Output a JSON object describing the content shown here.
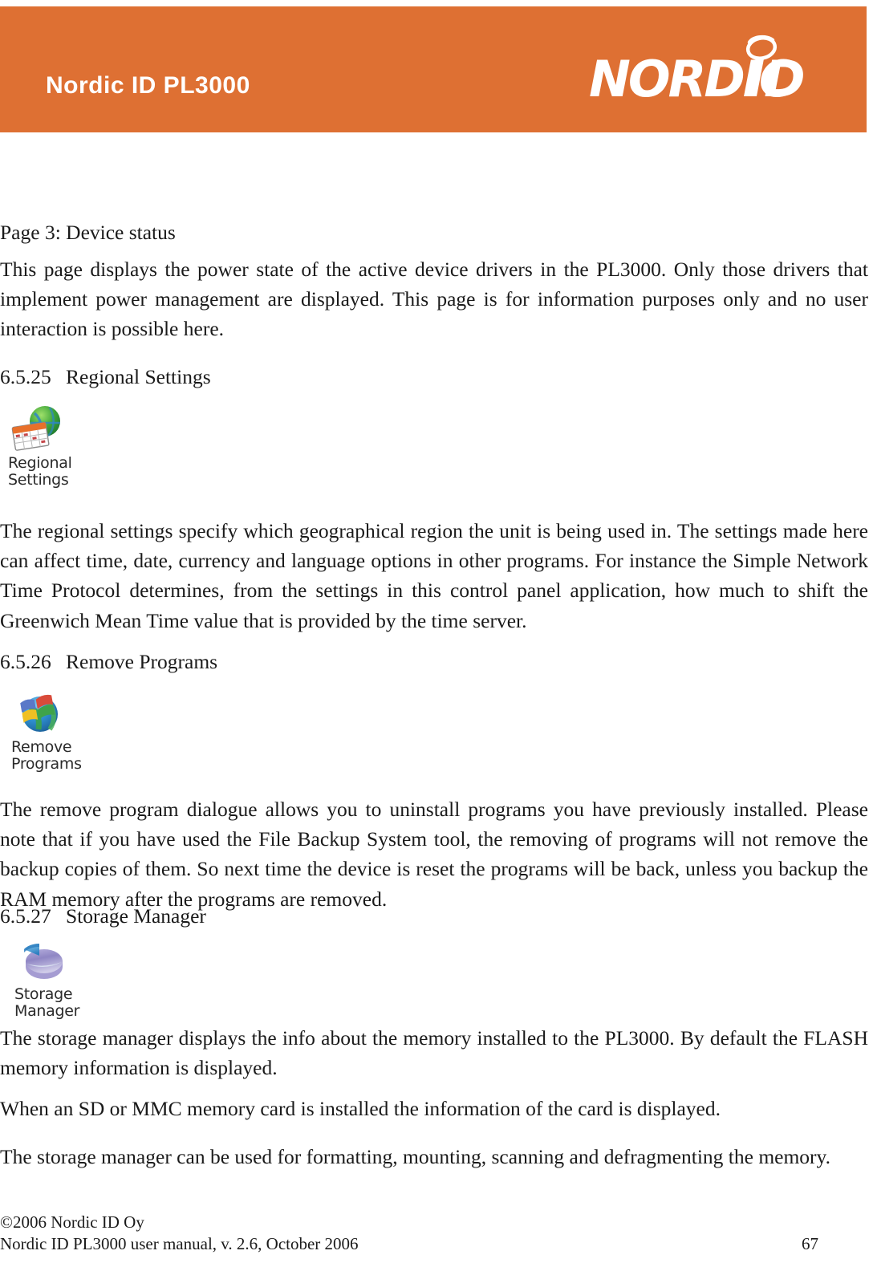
{
  "header": {
    "title": "Nordic ID PL3000",
    "logo_text": "NORDICID",
    "logo_name": "nordic-id-logo",
    "background_color": "#de7033"
  },
  "content": {
    "lead_line": "Page 3: Device status",
    "paragraph_1": "This page displays the power state of the active device drivers in the PL3000. Only those drivers that implement power management are displayed. This page is for information purposes only and no user interaction is possible here.",
    "sections": [
      {
        "number": "6.5.25",
        "title": "Regional Settings",
        "icon_name": "regional-settings-icon",
        "icon_caption": "Regional\nSettings",
        "paragraph": "The regional settings specify which geographical region the unit is being used in. The settings made here can affect time, date, currency and language options in other programs. For instance the Simple Network Time Protocol determines, from the settings in this control panel application, how much to shift the Greenwich Mean Time value that is provided by the time server."
      },
      {
        "number": "6.5.26",
        "title": "Remove Programs",
        "icon_name": "remove-programs-icon",
        "icon_caption": "Remove\nPrograms",
        "paragraph": "The remove program dialogue allows you to uninstall programs you have previously installed. Please note that if you have used the File Backup System tool, the removing of programs will not remove the backup copies of them. So next time the device is reset the programs will be back, unless you backup the RAM memory after the programs are removed."
      },
      {
        "number": "6.5.27",
        "title": "Storage Manager",
        "icon_name": "storage-manager-icon",
        "icon_caption": "Storage\nManager",
        "paragraph_1": "The storage manager displays the info about the memory installed to the PL3000. By default the FLASH memory information is displayed.",
        "paragraph_2": "When an SD or MMC memory card is installed the information of the card is displayed.",
        "paragraph_3": "The storage manager can be used for formatting, mounting, scanning and defragmenting the memory."
      }
    ]
  },
  "footer": {
    "copyright": "©2006 Nordic ID Oy",
    "manual_line": "Nordic ID PL3000 user manual, v. 2.6, October 2006",
    "page_number": "67"
  }
}
